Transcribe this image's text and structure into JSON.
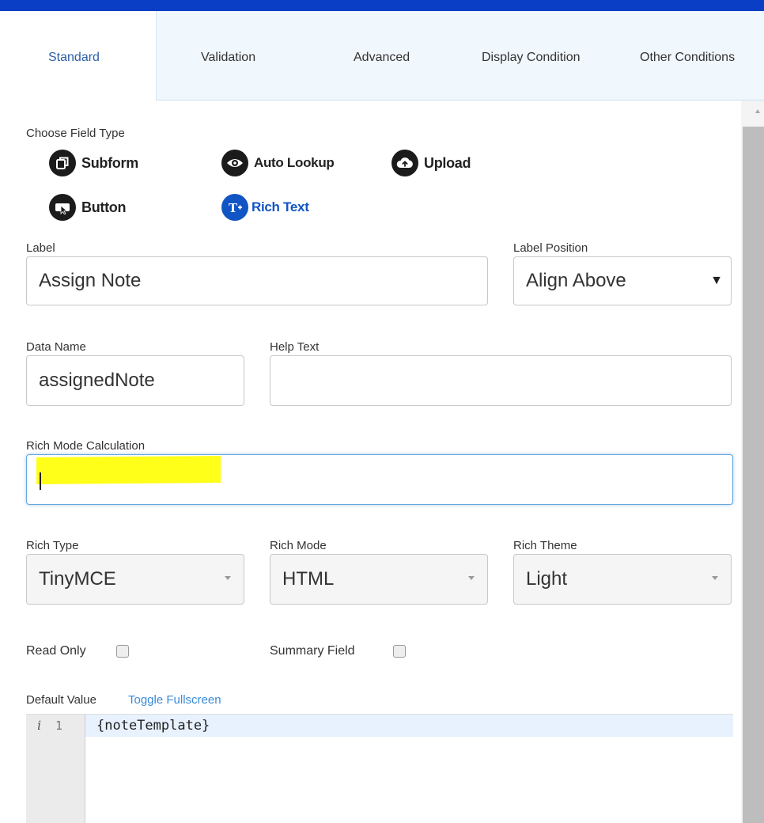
{
  "colors": {
    "topbar": "#0a3fc5",
    "tab_active": "#2d5fa8",
    "rich_text_accent": "#1155c4",
    "link": "#3a8ad6",
    "highlight": "#ffff19",
    "focus_border": "#66a8de"
  },
  "tabs": [
    {
      "label": "Standard",
      "active": true
    },
    {
      "label": "Validation",
      "active": false
    },
    {
      "label": "Advanced",
      "active": false
    },
    {
      "label": "Display Condition",
      "active": false
    },
    {
      "label": "Other Conditions",
      "active": false
    }
  ],
  "field_type": {
    "heading": "Choose Field Type",
    "options": [
      {
        "label": "Subform",
        "icon": "subform-icon",
        "selected": false
      },
      {
        "label": "Auto Lookup",
        "icon": "eye-icon",
        "selected": false
      },
      {
        "label": "Upload",
        "icon": "upload-cloud-icon",
        "selected": false
      },
      {
        "label": "Button",
        "icon": "cursor-click-icon",
        "selected": false
      },
      {
        "label": "Rich Text",
        "icon": "rich-text-icon",
        "selected": true
      }
    ]
  },
  "form": {
    "label": {
      "label": "Label",
      "value": "Assign Note"
    },
    "label_position": {
      "label": "Label Position",
      "value": "Align Above"
    },
    "data_name": {
      "label": "Data Name",
      "value": "assignedNote"
    },
    "help_text": {
      "label": "Help Text",
      "value": ""
    },
    "rich_mode_calculation": {
      "label": "Rich Mode Calculation",
      "value": ""
    },
    "rich_type": {
      "label": "Rich Type",
      "value": "TinyMCE"
    },
    "rich_mode": {
      "label": "Rich Mode",
      "value": "HTML"
    },
    "rich_theme": {
      "label": "Rich Theme",
      "value": "Light"
    },
    "read_only": {
      "label": "Read Only",
      "checked": false
    },
    "summary_field": {
      "label": "Summary Field",
      "checked": false
    },
    "default_value": {
      "label": "Default Value",
      "toggle_link": "Toggle Fullscreen",
      "gutter_icon": "i",
      "line_number": "1",
      "code": "{noteTemplate}"
    }
  }
}
